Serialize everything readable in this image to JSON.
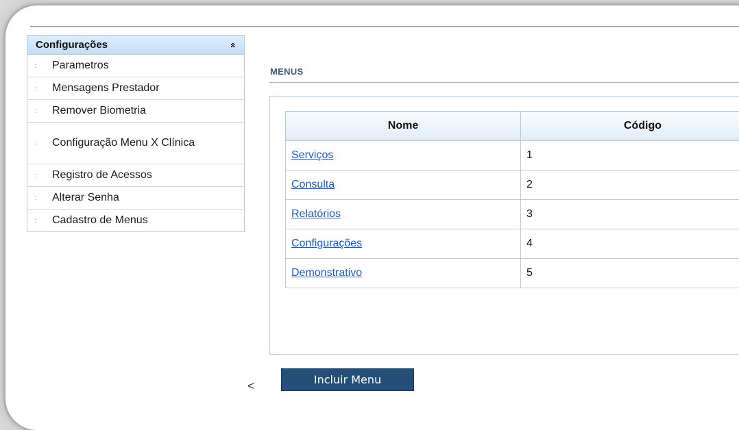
{
  "sidebar": {
    "title": "Configurações",
    "collapse_glyph": "«",
    "bullet_glyph": "::",
    "items": [
      {
        "label": "Parametros"
      },
      {
        "label": "Mensagens Prestador"
      },
      {
        "label": "Remover Biometria"
      },
      {
        "label": "Configuração Menu X Clínica"
      },
      {
        "label": "Registro de Acessos"
      },
      {
        "label": "Alterar Senha"
      },
      {
        "label": "Cadastro de Menus"
      }
    ],
    "back_glyph": "<"
  },
  "main": {
    "section_title": "MENUS",
    "table": {
      "headers": [
        "Nome",
        "Código"
      ],
      "rows": [
        {
          "nome": "Serviços",
          "codigo": "1"
        },
        {
          "nome": "Consulta",
          "codigo": "2"
        },
        {
          "nome": "Relatórios",
          "codigo": "3"
        },
        {
          "nome": "Configurações",
          "codigo": "4"
        },
        {
          "nome": "Demonstrativo",
          "codigo": "5"
        }
      ]
    },
    "include_button_label": "Incluir Menu"
  },
  "colors": {
    "header_blue": "#c5dcf5",
    "button_bg": "#244f78",
    "link": "#1f5bc4",
    "section_title": "#3c5a78"
  }
}
